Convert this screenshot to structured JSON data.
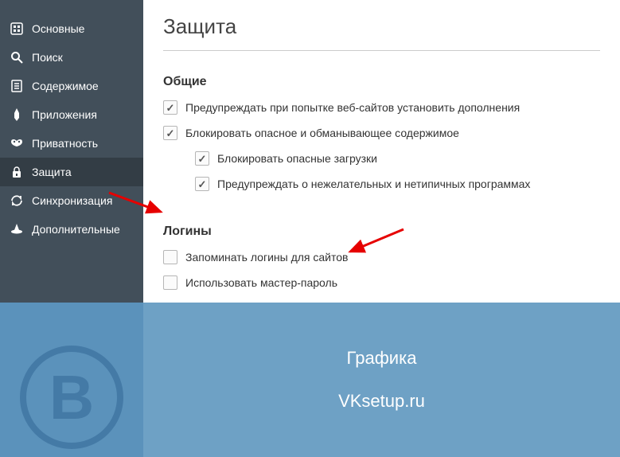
{
  "sidebar": {
    "items": [
      {
        "label": "Основные"
      },
      {
        "label": "Поиск"
      },
      {
        "label": "Содержимое"
      },
      {
        "label": "Приложения"
      },
      {
        "label": "Приватность"
      },
      {
        "label": "Защита"
      },
      {
        "label": "Синхронизация"
      },
      {
        "label": "Дополнительные"
      }
    ]
  },
  "page": {
    "title": "Защита"
  },
  "sections": {
    "general": {
      "heading": "Общие",
      "warn_addons": "Предупреждать при попытке веб-сайтов установить дополнения",
      "block_dangerous": "Блокировать опасное и обманывающее содержимое",
      "block_downloads": "Блокировать опасные загрузки",
      "warn_unwanted": "Предупреждать о нежелательных и нетипичных программах"
    },
    "logins": {
      "heading": "Логины",
      "remember": "Запоминать логины для сайтов",
      "master_pw": "Использовать мастер-пароль"
    }
  },
  "banner": {
    "logo_letter": "В",
    "line1": "Графика",
    "line2": "VKsetup.ru"
  }
}
